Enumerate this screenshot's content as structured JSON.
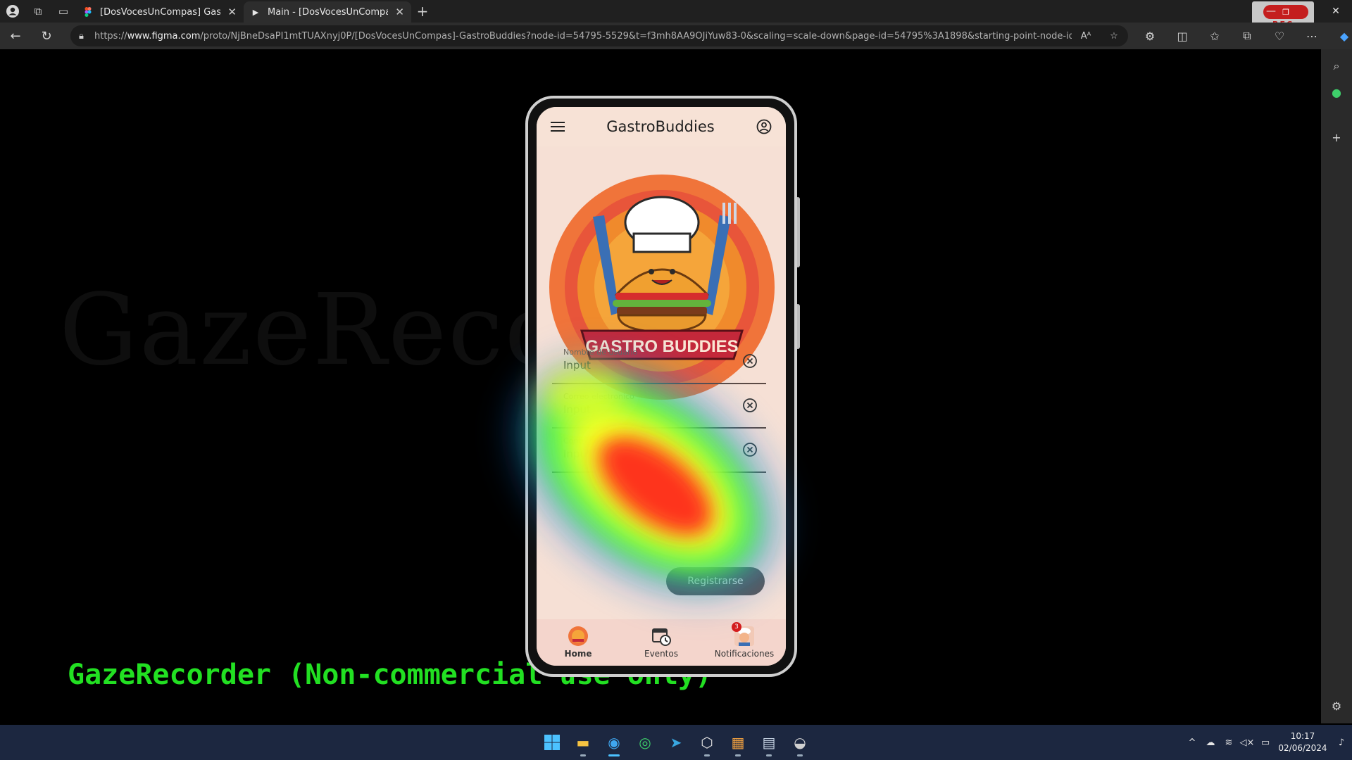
{
  "browser": {
    "tabs": [
      {
        "title": "[DosVocesUnCompas] GastroBuddies",
        "active": false
      },
      {
        "title": "Main - [DosVocesUnCompas] GastroBuddies",
        "active": true
      }
    ],
    "url_prefix": "https://",
    "url_domain": "www.figma.com",
    "url_rest": "/proto/NjBneDsaPI1mtTUAXnyj0P/[DosVocesUnCompas]-GastroBuddies?node-id=54795-5529&t=f3mh8AA9OJiYuw83-0&scaling=scale-down&page-id=54795%3A1898&starting-point-node-id=5...",
    "read_aloud": "Aᴬ",
    "rec_label": "REC"
  },
  "overlay": {
    "watermark": "GazeRecorder",
    "label": "GazeRecorder (Non-commercial use only)"
  },
  "app": {
    "title": "GastroBuddies",
    "logo_text": "GASTRO BUDDIES",
    "fields": [
      {
        "label": "Nombre de usuario",
        "value": "Input"
      },
      {
        "label": "Correo electronico",
        "value": "Input"
      },
      {
        "label": "Contraseña",
        "value": "Input"
      }
    ],
    "register_button": "Registrarse",
    "nav": [
      {
        "label": "Home",
        "active": true,
        "badge": ""
      },
      {
        "label": "Eventos",
        "active": false,
        "badge": ""
      },
      {
        "label": "Notificaciones",
        "active": false,
        "badge": "3"
      }
    ]
  },
  "taskbar": {
    "time": "10:17",
    "date": "02/06/2024"
  },
  "colors": {
    "app_background": "#f6e0d5",
    "logo_orange": "#f0743a",
    "heat_red": "#ff2a1a",
    "heat_green": "#3cf03c",
    "overlay_green": "#22e022"
  }
}
